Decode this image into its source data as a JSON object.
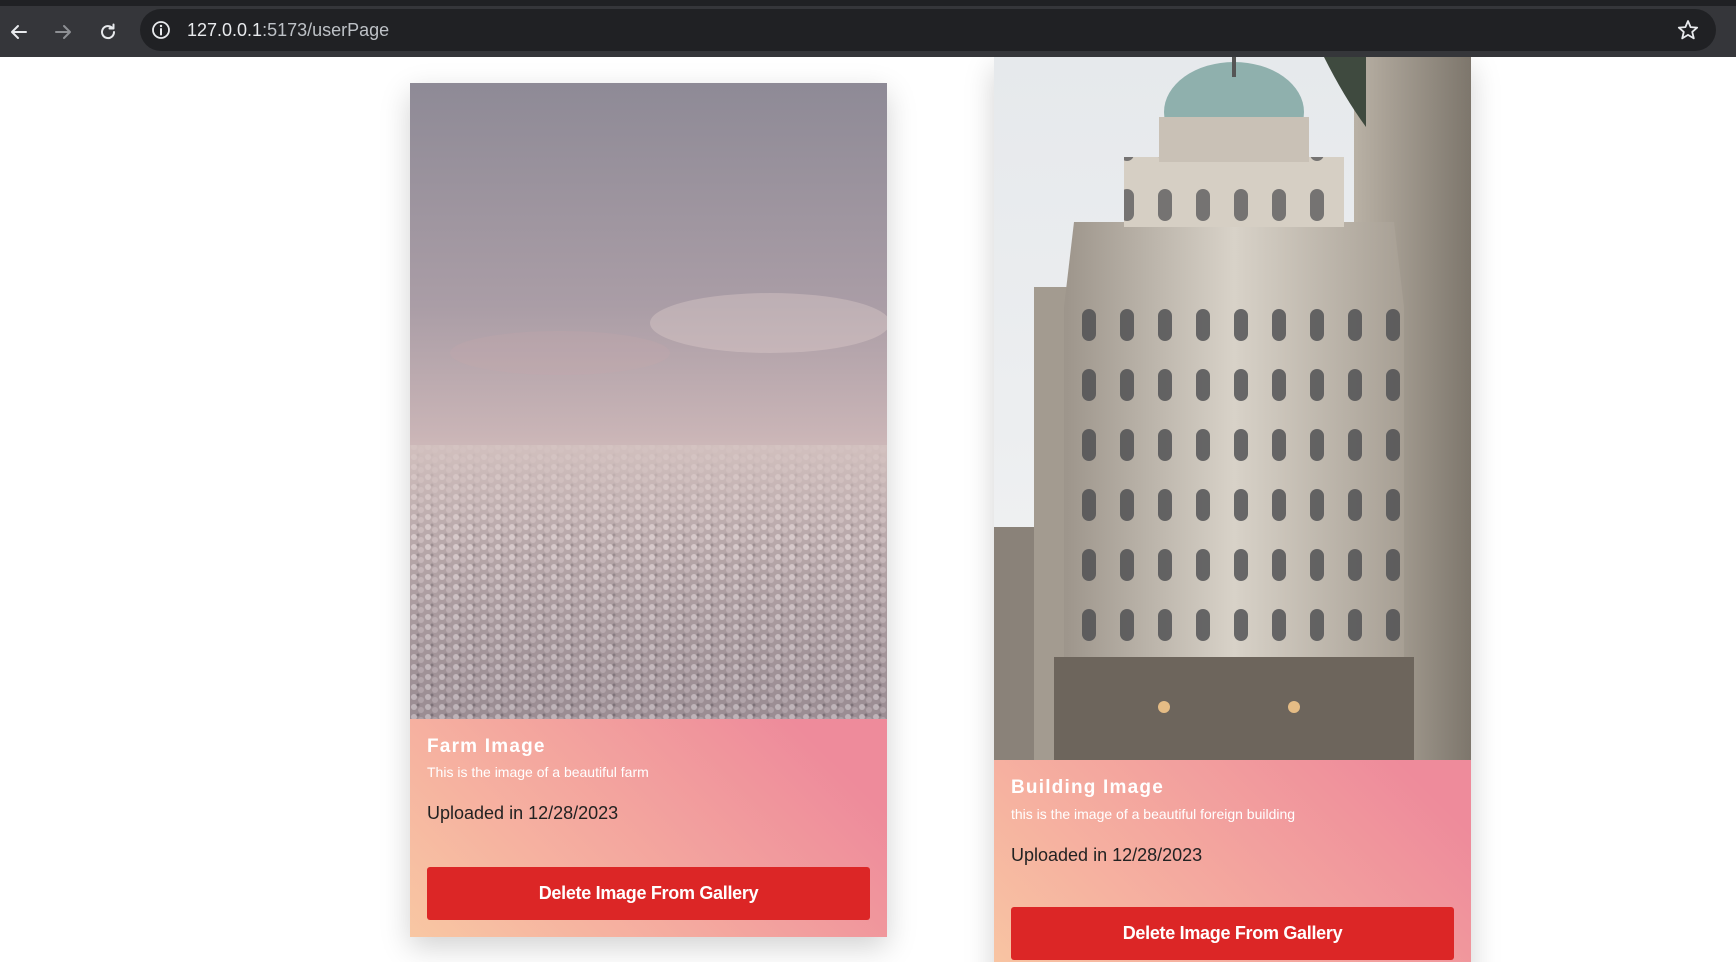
{
  "browser": {
    "url_host": "127.0.0.1",
    "url_path": ":5173/userPage",
    "back_icon": "arrow-left-icon",
    "forward_icon": "arrow-right-icon",
    "reload_icon": "reload-icon",
    "info_icon": "info-icon",
    "bookmark_icon": "star-icon"
  },
  "gallery": {
    "cards": [
      {
        "image_subject": "snow-covered forest under pink misty sky",
        "title": "Farm Image",
        "description": "This is the image of a beautiful farm",
        "uploaded": "Uploaded in 12/28/2023",
        "delete_label": "Delete Image From Gallery"
      },
      {
        "image_subject": "historic domed corner building",
        "title": "Building Image",
        "description": "this is the image of a beautiful foreign building",
        "uploaded": "Uploaded in 12/28/2023",
        "delete_label": "Delete Image From Gallery"
      }
    ]
  },
  "colors": {
    "browser_bar": "#35363a",
    "address_bar": "#202124",
    "card_gradient_main": "#ee8b9b",
    "card_gradient_corner": "#f8c7a3",
    "delete_button": "#dc2626"
  }
}
